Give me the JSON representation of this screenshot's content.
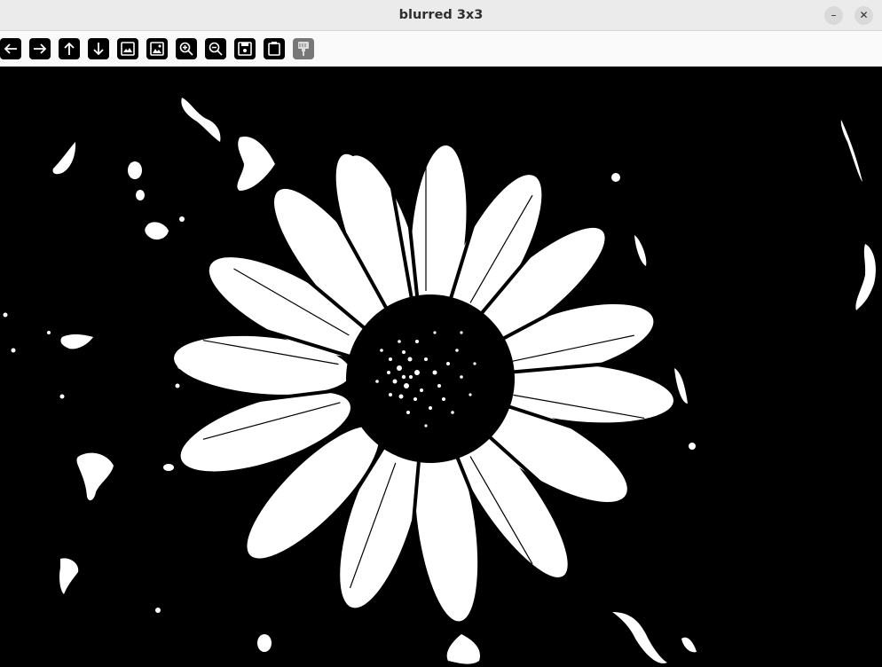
{
  "window": {
    "title": "blurred 3x3"
  },
  "controls": {
    "minimize_glyph": "–",
    "close_glyph": "✕"
  },
  "toolbar": {
    "buttons": [
      {
        "name": "back-button",
        "icon": "arrow-left-icon"
      },
      {
        "name": "forward-button",
        "icon": "arrow-right-icon"
      },
      {
        "name": "up-button",
        "icon": "arrow-up-icon"
      },
      {
        "name": "down-button",
        "icon": "arrow-down-icon"
      },
      {
        "name": "fit-image-button",
        "icon": "image-icon"
      },
      {
        "name": "original-size-button",
        "icon": "image-alt-icon"
      },
      {
        "name": "zoom-in-button",
        "icon": "zoom-in-icon"
      },
      {
        "name": "zoom-out-button",
        "icon": "zoom-out-icon"
      },
      {
        "name": "save-button",
        "icon": "save-icon"
      },
      {
        "name": "copy-button",
        "icon": "clipboard-icon"
      },
      {
        "name": "properties-button",
        "icon": "brush-icon",
        "disabled": true
      }
    ]
  },
  "image": {
    "description_icon": "flower-image",
    "foreground": "#ffffff",
    "background": "#000000"
  }
}
